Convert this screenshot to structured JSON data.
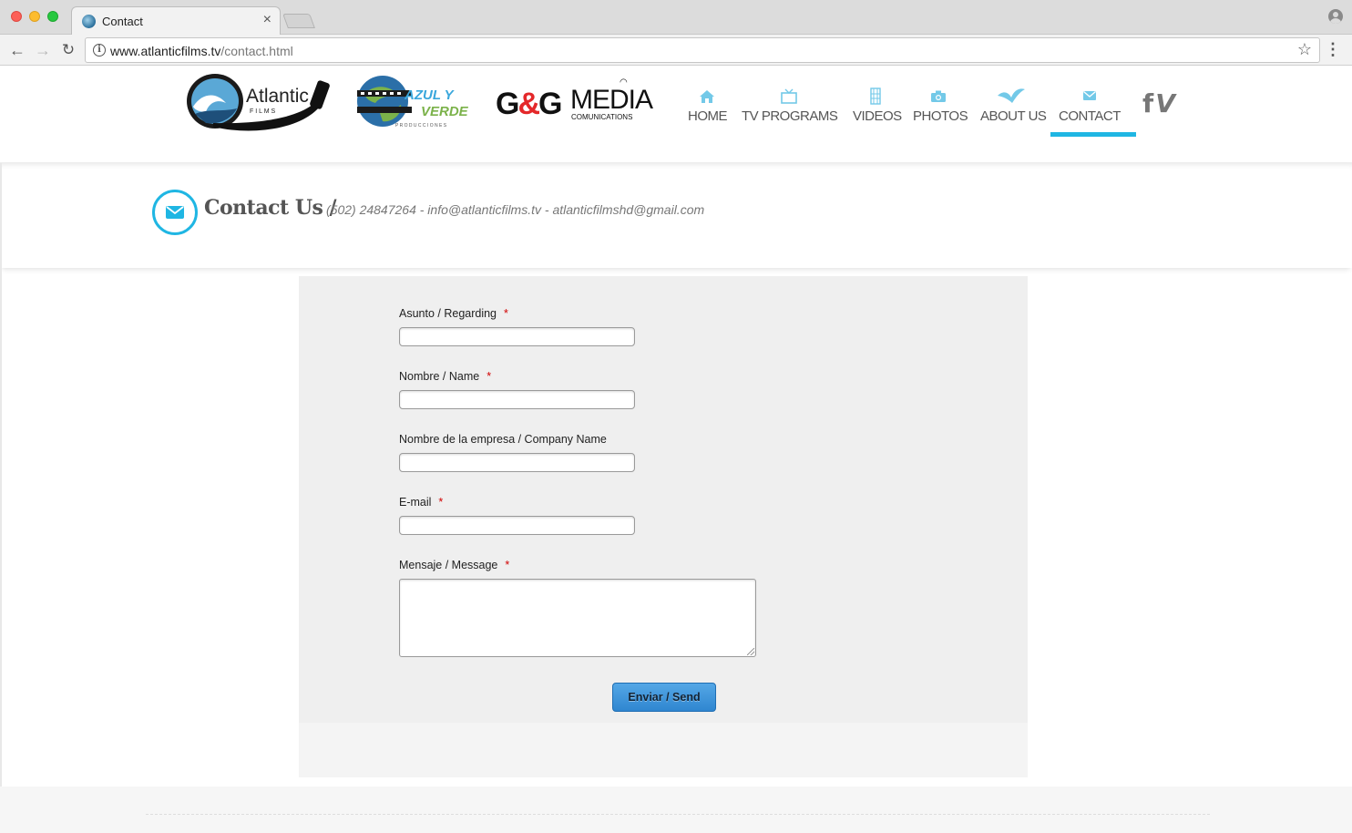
{
  "browser": {
    "tab_title": "Contact",
    "tab_close": "×",
    "url_host": "www.atlanticfilms.tv",
    "url_path": "/contact.html",
    "back": "←",
    "forward": "→",
    "reload": "↻",
    "info": "i",
    "star": "☆",
    "menu": "⋮"
  },
  "logos": {
    "atlantic": {
      "name": "Atlantic",
      "sub": "F I L M S"
    },
    "azul": {
      "line1": "AZUL Y",
      "line2": "VERDE",
      "sub": "P R O D U C C I O N E S"
    },
    "gg": {
      "mark_g1": "G",
      "mark_amp": "&",
      "mark_g2": "G",
      "name": "MEDIA",
      "sub": "COMUNICATIONS"
    }
  },
  "nav": {
    "items": [
      {
        "label": "HOME",
        "icon": "home-icon"
      },
      {
        "label": "TV PROGRAMS",
        "icon": "tv-icon"
      },
      {
        "label": "VIDEOS",
        "icon": "film-icon"
      },
      {
        "label": "PHOTOS",
        "icon": "camera-icon"
      },
      {
        "label": "ABOUT US",
        "icon": "bird-icon"
      },
      {
        "label": "CONTACT",
        "icon": "mail-icon",
        "active": true
      }
    ],
    "accent_color": "#1fb6e3",
    "social": {
      "facebook": "f",
      "vimeo": "V"
    }
  },
  "header": {
    "title": "Contact Us /",
    "subtitle": "(502) 24847264 - info@atlanticfilms.tv - atlanticfilmshd@gmail.com"
  },
  "form": {
    "fields": [
      {
        "label": "Asunto / Regarding",
        "required": "*",
        "value": ""
      },
      {
        "label": "Nombre / Name",
        "required": "*",
        "value": ""
      },
      {
        "label": "Nombre de la empresa / Company Name",
        "required": "",
        "value": ""
      },
      {
        "label": "E-mail",
        "required": "*",
        "value": ""
      },
      {
        "label": "Mensaje / Message",
        "required": "*",
        "value": ""
      }
    ],
    "submit_label": "Enviar / Send"
  }
}
